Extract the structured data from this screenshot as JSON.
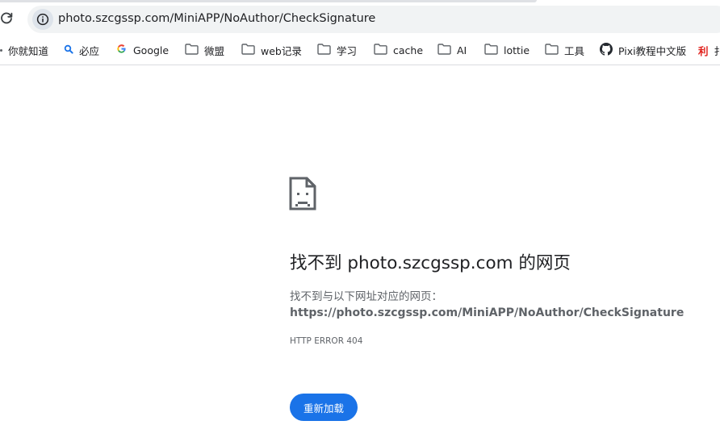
{
  "address_bar": {
    "url": "photo.szcgssp.com/MiniAPP/NoAuthor/CheckSignature"
  },
  "bookmarks": [
    {
      "label": "你就知道",
      "icon": "none"
    },
    {
      "label": "必应",
      "icon": "bing-search-icon"
    },
    {
      "label": "Google",
      "icon": "google-icon"
    },
    {
      "label": "微盟",
      "icon": "folder-icon"
    },
    {
      "label": "web记录",
      "icon": "folder-icon"
    },
    {
      "label": "学习",
      "icon": "folder-icon"
    },
    {
      "label": "cache",
      "icon": "folder-icon"
    },
    {
      "label": "AI",
      "icon": "folder-icon"
    },
    {
      "label": "lottie",
      "icon": "folder-icon"
    },
    {
      "label": "工具",
      "icon": "folder-icon"
    },
    {
      "label": "Pixi教程中文版",
      "icon": "github-icon"
    },
    {
      "label": "利",
      "icon": "red-text-icon"
    }
  ],
  "error": {
    "title": "找不到 photo.szcgssp.com 的网页",
    "description": "找不到与以下网址对应的网页：",
    "url": "https://photo.szcgssp.com/MiniAPP/NoAuthor/CheckSignature",
    "code": "HTTP ERROR 404",
    "reload_label": "重新加载"
  },
  "colors": {
    "accent": "#1a73e8",
    "text": "#202124",
    "secondary_text": "#5f6368",
    "omnibox": "#f1f3f4"
  }
}
